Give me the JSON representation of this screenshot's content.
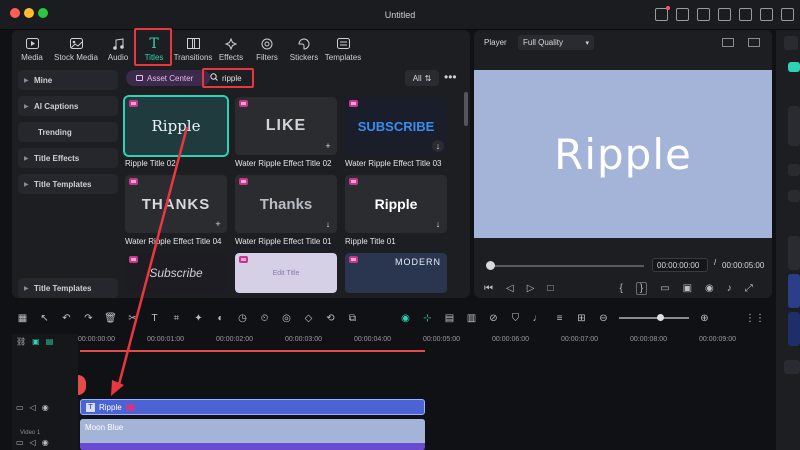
{
  "window": {
    "title": "Untitled"
  },
  "toolbar": {
    "items": [
      {
        "label": "Media",
        "icon": "media-icon"
      },
      {
        "label": "Stock Media",
        "icon": "stock-media-icon"
      },
      {
        "label": "Audio",
        "icon": "music-note-icon"
      },
      {
        "label": "Titles",
        "icon": "title-t-icon",
        "active": true
      },
      {
        "label": "Transitions",
        "icon": "transitions-icon"
      },
      {
        "label": "Effects",
        "icon": "effects-icon"
      },
      {
        "label": "Filters",
        "icon": "filters-icon"
      },
      {
        "label": "Stickers",
        "icon": "stickers-icon"
      },
      {
        "label": "Templates",
        "icon": "templates-icon"
      }
    ]
  },
  "sidebar": {
    "items": [
      "Mine",
      "AI Captions",
      "Trending",
      "Title Effects",
      "Title Templates"
    ],
    "bottom": "Title Templates"
  },
  "library": {
    "asset_center": "Asset Center",
    "search_value": "ripple",
    "filter": "All",
    "cards": [
      {
        "label": "Ripple Title 02",
        "thumb": "Ripple"
      },
      {
        "label": "Water Ripple Effect Title 02",
        "thumb": "LIKE"
      },
      {
        "label": "Water Ripple Effect Title 03",
        "thumb": "SUBSCRIBE"
      },
      {
        "label": "Water Ripple Effect Title 04",
        "thumb": "THANKS"
      },
      {
        "label": "Water Ripple Effect Title 01",
        "thumb": "Thanks"
      },
      {
        "label": "Ripple Title 01",
        "thumb": "Ripple"
      },
      {
        "label": "",
        "thumb": "Subscribe"
      },
      {
        "label": "",
        "thumb": "Edit Title"
      },
      {
        "label": "",
        "thumb": "MODERN"
      }
    ]
  },
  "player": {
    "label": "Player",
    "quality": "Full Quality",
    "preview_text": "Ripple",
    "current_time": "00:00:00:00",
    "separator": "/",
    "total_time": "00:00:05:00"
  },
  "timeline": {
    "ticks": [
      "00:00:00:00",
      "00:00:01:00",
      "00:00:02:00",
      "00:00:03:00",
      "00:00:04:00",
      "00:00:05:00",
      "00:00:06:00",
      "00:00:07:00",
      "00:00:08:00",
      "00:00:09:00"
    ],
    "title_clip": "Ripple",
    "video_clip": "Moon Blue",
    "video_track": "Video 1"
  },
  "colors": {
    "accent": "#2fd2b4",
    "highlight": "#e9373f",
    "title_clip": "#4a64d6",
    "preview_bg": "#a4b3d8"
  }
}
